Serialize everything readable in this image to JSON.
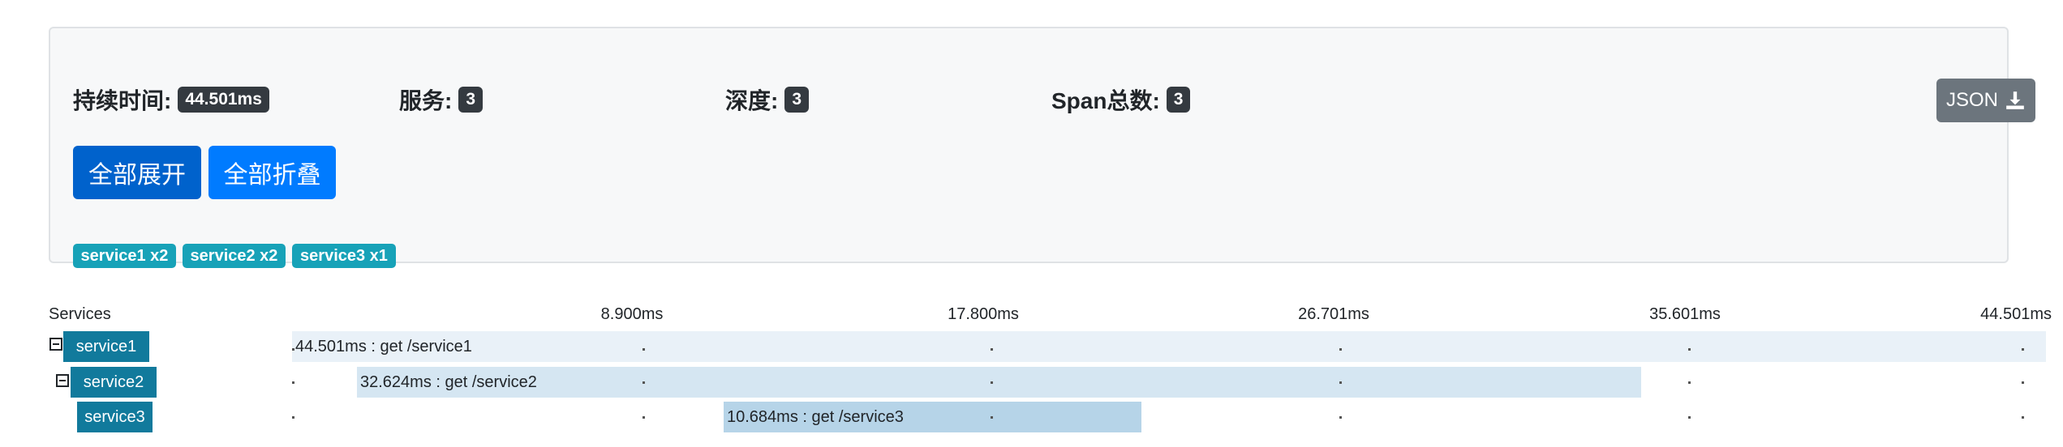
{
  "summary": {
    "duration_label": "持续时间:",
    "duration_value": "44.501ms",
    "services_label": "服务:",
    "services_value": "3",
    "depth_label": "深度:",
    "depth_value": "3",
    "span_total_label": "Span总数:",
    "span_total_value": "3",
    "json_button": "JSON",
    "json_icon": "download-icon",
    "expand_all": "全部展开",
    "collapse_all": "全部折叠",
    "service_badges": [
      "service1 x2",
      "service2 x2",
      "service3 x1"
    ]
  },
  "timeline": {
    "header_label": "Services",
    "ticks": [
      "8.900ms",
      "17.800ms",
      "26.701ms",
      "35.601ms",
      "44.501ms"
    ],
    "rows": [
      {
        "service": "service1",
        "span_text": "44.501ms : get /service1",
        "collapsible": true,
        "start_ms": 0,
        "duration_ms": 44.501
      },
      {
        "service": "service2",
        "span_text": "32.624ms : get /service2",
        "collapsible": true,
        "start_ms": 1.66,
        "duration_ms": 32.624
      },
      {
        "service": "service3",
        "span_text": "10.684ms : get /service3",
        "collapsible": false,
        "start_ms": 11.1,
        "duration_ms": 10.684
      }
    ]
  },
  "colors": {
    "primary": "#007bff",
    "primary_active": "#0062cc",
    "info": "#17a2b8",
    "service_label": "#117a9c",
    "span_bar_level1": "#e9f1f8",
    "span_bar_level2": "#d5e6f2",
    "span_bar_level3": "#b6d4e8"
  }
}
